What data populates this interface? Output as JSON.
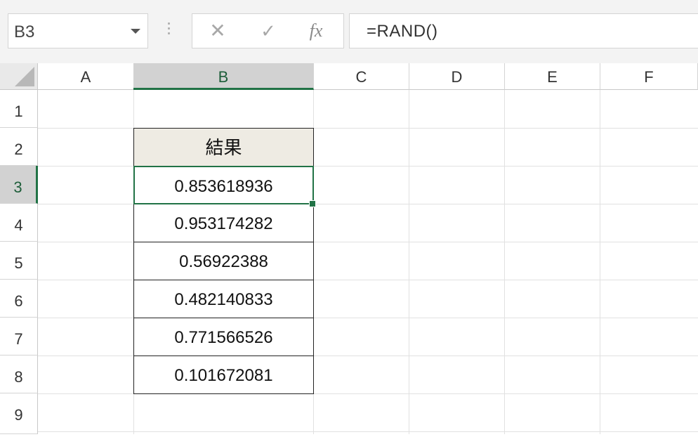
{
  "name_box": {
    "value": "B3"
  },
  "formula_bar": {
    "cancel_icon": "✕",
    "enter_icon": "✓",
    "insert_function_label": "fx",
    "formula": "=RAND()"
  },
  "columns": [
    "A",
    "B",
    "C",
    "D",
    "E",
    "F"
  ],
  "selected_column": "B",
  "rows": [
    "1",
    "2",
    "3",
    "4",
    "5",
    "6",
    "7",
    "8",
    "9"
  ],
  "selected_row": "3",
  "table": {
    "header": "結果",
    "values": [
      "0.853618936",
      "0.953174282",
      "0.56922388",
      "0.482140833",
      "0.771566526",
      "0.101672081"
    ]
  },
  "colors": {
    "accent": "#217346",
    "header_fill": "#eeebe3"
  }
}
